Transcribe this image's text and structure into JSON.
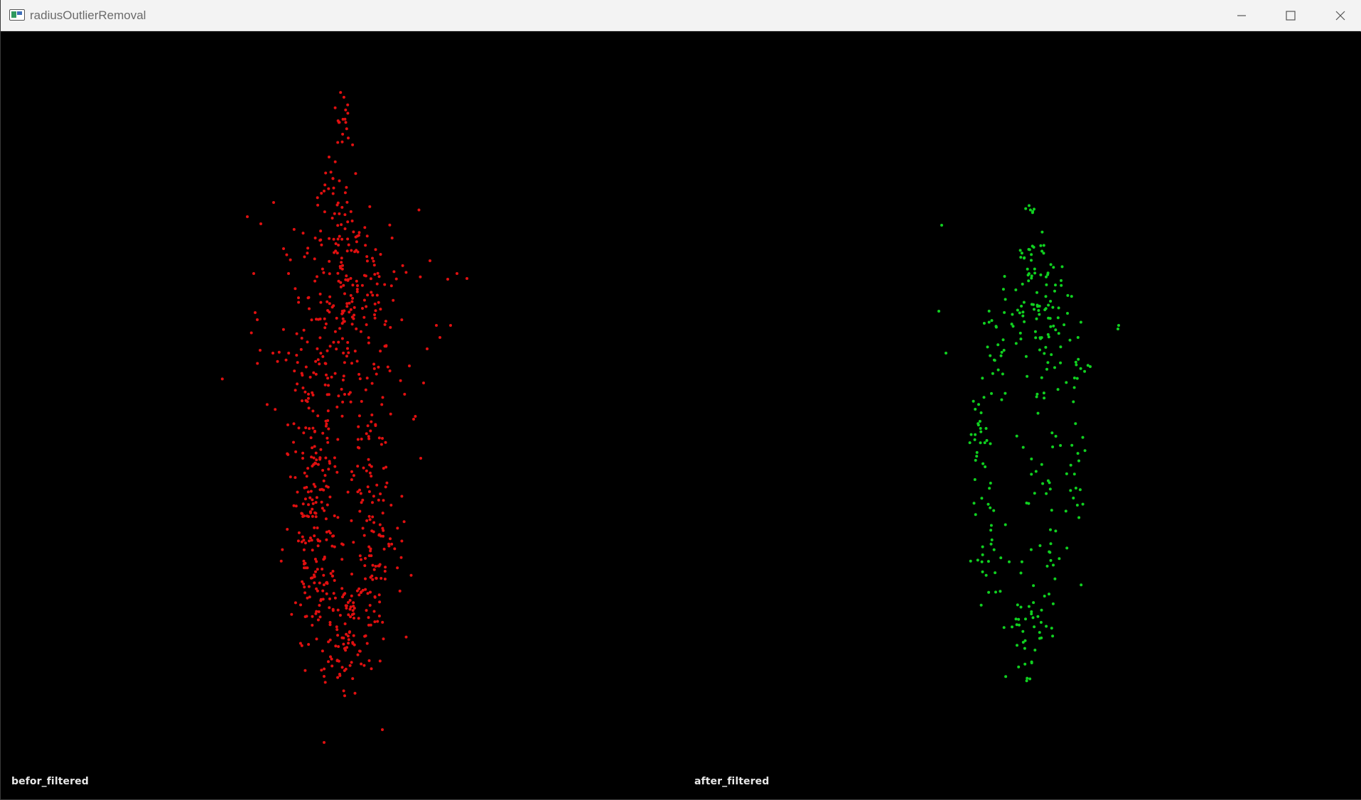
{
  "window": {
    "title": "radiusOutlierRemoval",
    "icon": "pcl-viewer-app-icon",
    "controls": {
      "minimize_icon": "minimize-icon",
      "maximize_icon": "maximize-icon",
      "close_icon": "close-icon"
    }
  },
  "viewport": {
    "background": "#000000",
    "left_view": {
      "label": "befor_filtered",
      "point_color": "#e01010"
    },
    "right_view": {
      "label": "after_filtered",
      "point_color": "#10d020"
    }
  }
}
